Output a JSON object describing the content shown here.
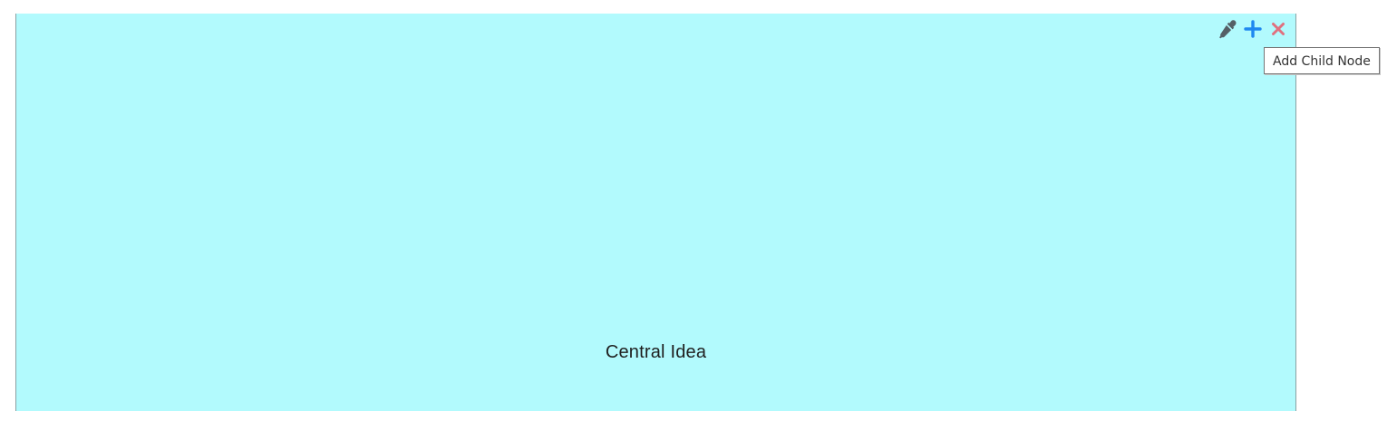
{
  "node": {
    "label": "Central Idea",
    "background_color": "#b2fafd",
    "toolbar": [
      {
        "icon": "eyedropper-icon",
        "color": "#555f66"
      },
      {
        "icon": "plus-icon",
        "color": "#1e88f0"
      },
      {
        "icon": "close-icon",
        "color": "#e0707e"
      }
    ]
  },
  "tooltip": {
    "text": "Add Child Node"
  }
}
